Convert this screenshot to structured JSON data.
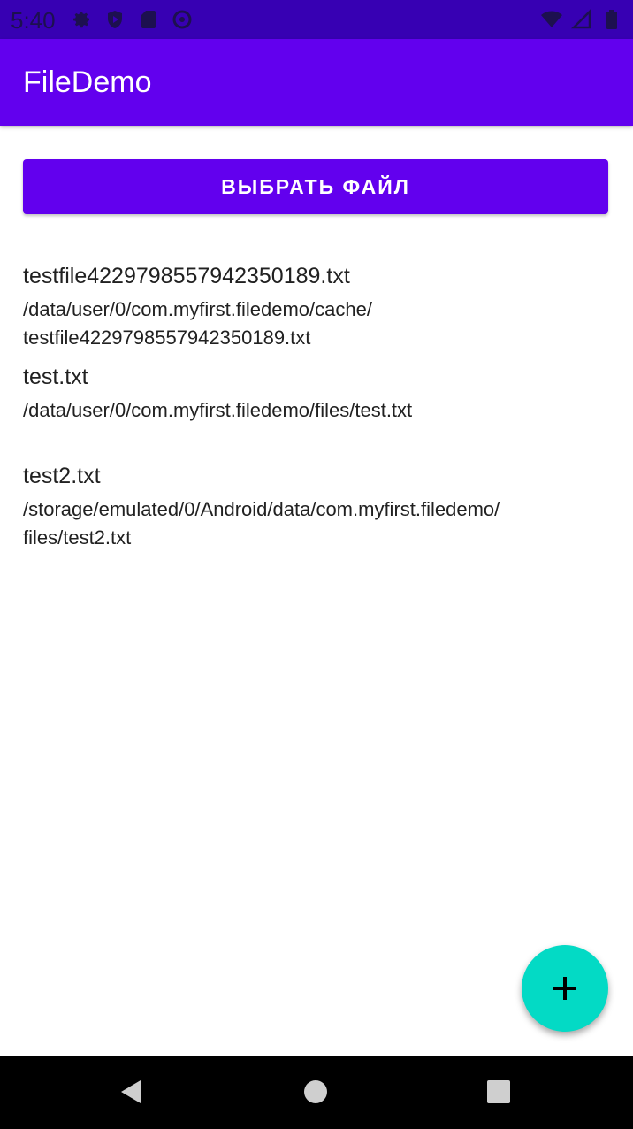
{
  "status_bar": {
    "time": "5:40",
    "left_icons": [
      "gear-icon",
      "shield-icon",
      "sd-card-icon",
      "sync-icon"
    ],
    "right_icons": [
      "wifi-icon",
      "signal-icon",
      "battery-icon"
    ]
  },
  "app_bar": {
    "title": "FileDemo"
  },
  "main": {
    "select_button_label": "ВЫБРАТЬ ФАЙЛ",
    "files": [
      {
        "name": "testfile4229798557942350189.txt",
        "path_line1": "/data/user/0/com.myfirst.filedemo/cache/",
        "path_line2": "testfile4229798557942350189.txt"
      },
      {
        "name": "test.txt",
        "path_line1": "/data/user/0/com.myfirst.filedemo/files/test.txt",
        "path_line2": ""
      },
      {
        "name": "test2.txt",
        "path_line1": "/storage/emulated/0/Android/data/com.myfirst.filedemo/",
        "path_line2": "files/test2.txt"
      }
    ]
  },
  "fab": {
    "icon": "plus-icon",
    "color": "#03dac5"
  },
  "navigation": {
    "icons": [
      "back-icon",
      "home-icon",
      "recents-icon"
    ]
  },
  "colors": {
    "primary": "#6200ee",
    "primary_dark": "#3700b3",
    "accent": "#03dac5"
  }
}
